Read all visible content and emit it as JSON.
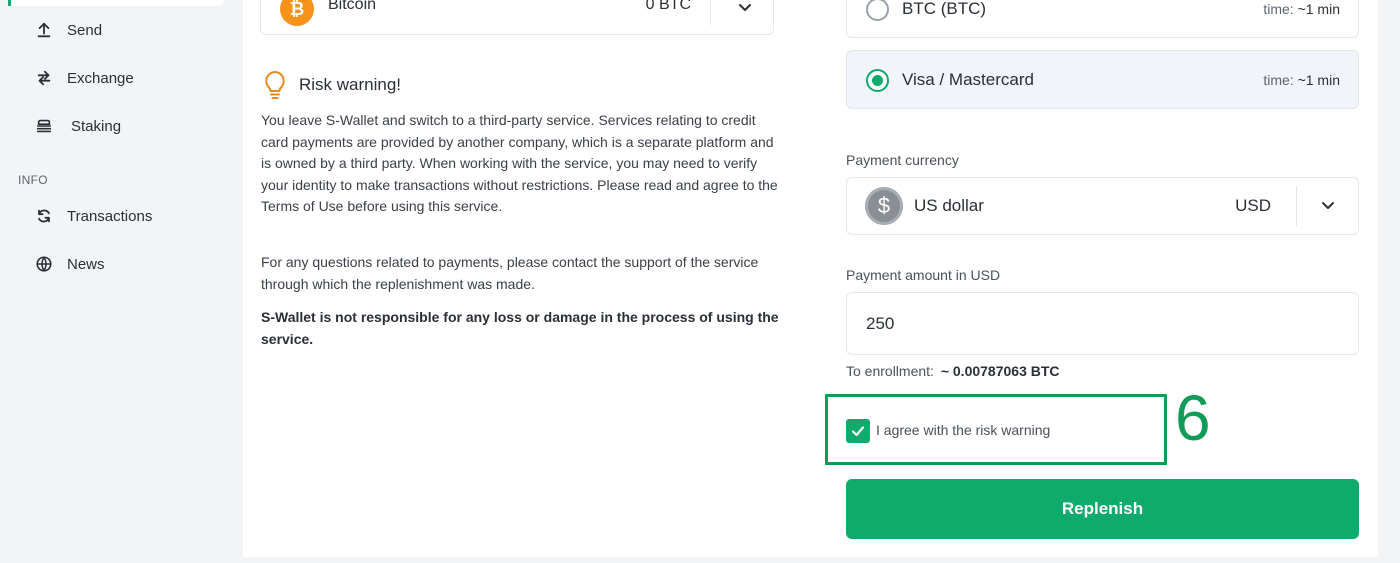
{
  "sidebar": {
    "items": [
      {
        "label": "Send",
        "icon": "upload-arrow-icon"
      },
      {
        "label": "Exchange",
        "icon": "exchange-arrows-icon"
      },
      {
        "label": "Staking",
        "icon": "staking-stack-icon"
      }
    ],
    "info_section": {
      "label": "INFO",
      "items": [
        {
          "label": "Transactions",
          "icon": "refresh-icon"
        },
        {
          "label": "News",
          "icon": "globe-icon"
        }
      ]
    }
  },
  "asset": {
    "name": "Bitcoin",
    "balance": "0 BTC",
    "icon": "bitcoin-icon",
    "coin_glyph": "₿"
  },
  "risk_warning": {
    "title": "Risk warning!",
    "icon": "lightbulb-icon",
    "paragraph1": "You leave S-Wallet and switch to a third-party service. Services relating to credit card payments are provided by another company, which is a separate platform and is owned by a third party. When working with the service, you may need to verify your identity to make transactions without restrictions. Please read and agree to the Terms of Use before using this service.",
    "paragraph2": "For any questions related to payments, please contact the support of the service through which the replenishment was made.",
    "paragraph3": "S-Wallet is not responsible for any loss or damage in the process of using the service."
  },
  "payment_methods": [
    {
      "name": "BTC (BTC)",
      "time_label": "time:",
      "time_value": "~1 min",
      "selected": false
    },
    {
      "name": "Visa / Mastercard",
      "time_label": "time:",
      "time_value": "~1 min",
      "selected": true
    }
  ],
  "payment_currency": {
    "label": "Payment currency",
    "name": "US dollar",
    "code": "USD",
    "coin_glyph": "$"
  },
  "payment_amount": {
    "label": "Payment amount in USD",
    "value": "250"
  },
  "enrollment": {
    "label": "To enrollment:",
    "value": "~ 0.00787063 BTC"
  },
  "agreement": {
    "label": "I agree with the risk warning",
    "checked": true
  },
  "annotation": {
    "step_number": "6"
  },
  "actions": {
    "replenish_label": "Replenish"
  },
  "colors": {
    "accent": "#0eab6c",
    "annotation": "#109b56",
    "bitcoin": "#f7931a",
    "warning_icon": "#e8891c"
  }
}
